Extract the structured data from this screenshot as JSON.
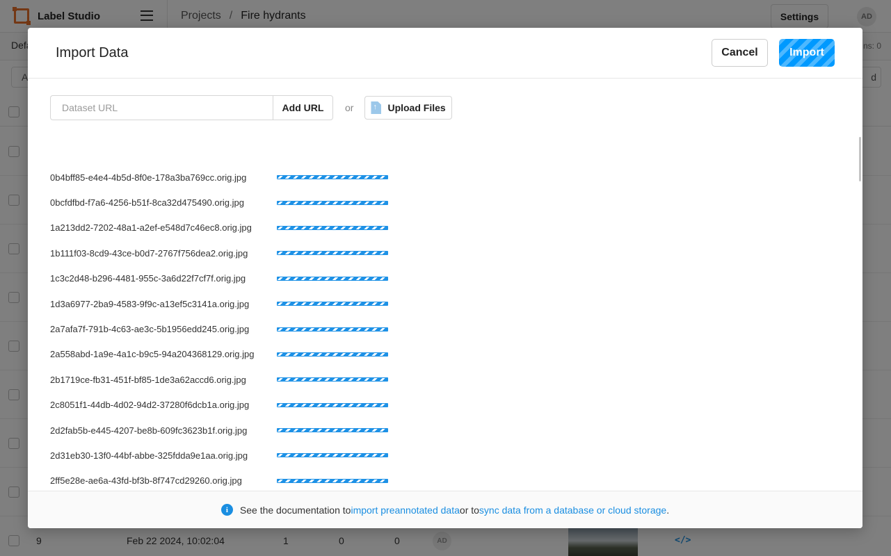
{
  "app": {
    "brand": "Label Studio",
    "breadcrumb": {
      "root": "Projects",
      "separator": "/",
      "current": "Fire hydrants"
    },
    "settings_label": "Settings",
    "user_initials": "AD",
    "tab_label": "Defa",
    "annotations_label": "ns: 0",
    "toolbar_left": "A",
    "toolbar_right": "d",
    "visible_row": {
      "id": "9",
      "date": "Feb 22 2024, 10:02:04",
      "total": "1",
      "cancelled": "0",
      "predictions": "0",
      "annotator": "AD"
    }
  },
  "modal": {
    "title": "Import Data",
    "cancel_label": "Cancel",
    "import_label": "Import",
    "url_placeholder": "Dataset URL",
    "add_url_label": "Add URL",
    "or_label": "or",
    "upload_label": "Upload Files",
    "files": [
      "0b4bff85-e4e4-4b5d-8f0e-178a3ba769cc.orig.jpg",
      "0bcfdfbd-f7a6-4256-b51f-8ca32d475490.orig.jpg",
      "1a213dd2-7202-48a1-a2ef-e548d7c46ec8.orig.jpg",
      "1b111f03-8cd9-43ce-b0d7-2767f756dea2.orig.jpg",
      "1c3c2d48-b296-4481-955c-3a6d22f7cf7f.orig.jpg",
      "1d3a6977-2ba9-4583-9f9c-a13ef5c3141a.orig.jpg",
      "2a7afa7f-791b-4c63-ae3c-5b1956edd245.orig.jpg",
      "2a558abd-1a9e-4a1c-b9c5-94a204368129.orig.jpg",
      "2b1719ce-fb31-451f-bf85-1de3a62accd6.orig.jpg",
      "2c8051f1-44db-4d02-94d2-37280f6dcb1a.orig.jpg",
      "2d2fab5b-e445-4207-be8b-609fc3623b1f.orig.jpg",
      "2d31eb30-13f0-44bf-abbe-325fdda9e1aa.orig.jpg",
      "2ff5e28e-ae6a-43fd-bf3b-8f747cd29260.orig.jpg"
    ],
    "footer": {
      "prefix": "See the documentation to ",
      "link1": "import preannotated data",
      "middle": " or to ",
      "link2": "sync data from a database or cloud storage",
      "suffix": "."
    }
  },
  "colors": {
    "accent": "#1a8ee1",
    "import_button": "#0099ff",
    "logo": "#e8702a"
  }
}
